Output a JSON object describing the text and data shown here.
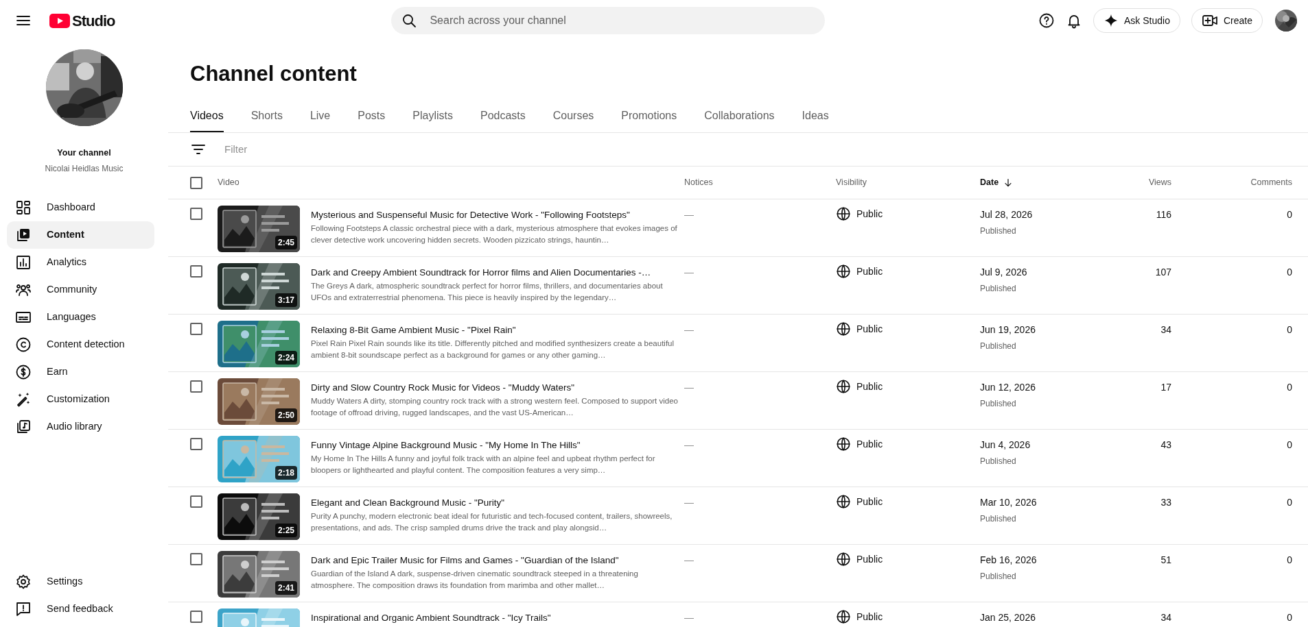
{
  "header": {
    "logo_text": "Studio",
    "search": {
      "placeholder": "Search across your channel"
    },
    "ask_button": "Ask Studio",
    "create_button": "Create"
  },
  "sidebar": {
    "channel_label": "Your channel",
    "channel_name": "Nicolai Heidlas Music",
    "items": [
      {
        "label": "Dashboard",
        "selected": false
      },
      {
        "label": "Content",
        "selected": true
      },
      {
        "label": "Analytics",
        "selected": false
      },
      {
        "label": "Community",
        "selected": false
      },
      {
        "label": "Languages",
        "selected": false
      },
      {
        "label": "Content detection",
        "selected": false
      },
      {
        "label": "Earn",
        "selected": false
      },
      {
        "label": "Customization",
        "selected": false
      },
      {
        "label": "Audio library",
        "selected": false
      }
    ],
    "footer_items": [
      {
        "label": "Settings"
      },
      {
        "label": "Send feedback"
      }
    ]
  },
  "page_title": "Channel content",
  "tabs": [
    {
      "label": "Videos",
      "selected": true
    },
    {
      "label": "Shorts",
      "selected": false
    },
    {
      "label": "Live",
      "selected": false
    },
    {
      "label": "Posts",
      "selected": false
    },
    {
      "label": "Playlists",
      "selected": false
    },
    {
      "label": "Podcasts",
      "selected": false
    },
    {
      "label": "Courses",
      "selected": false
    },
    {
      "label": "Promotions",
      "selected": false
    },
    {
      "label": "Collaborations",
      "selected": false
    },
    {
      "label": "Ideas",
      "selected": false
    }
  ],
  "filter": {
    "placeholder": "Filter"
  },
  "table": {
    "select_all": {
      "checked": false
    },
    "columns": [
      {
        "label": "Video",
        "sorted": false
      },
      {
        "label": "Notices",
        "sorted": false
      },
      {
        "label": "Visibility",
        "sorted": false
      },
      {
        "label": "Date",
        "sorted": true
      },
      {
        "label": "Views",
        "sorted": false
      },
      {
        "label": "Comments",
        "sorted": false
      }
    ],
    "rows": [
      {
        "checked": false,
        "duration": "2:45",
        "title": "Mysterious and Suspenseful Music for Detective Work - \"Following Footsteps\"",
        "description": "Following Footsteps A classic orchestral piece with a dark, mysterious atmosphere that evokes images of clever detective work uncovering hidden secrets. Wooden pizzicato strings, hauntin…",
        "notices": "—",
        "visibility": "Public",
        "date": "Jul 28, 2026",
        "status": "Published",
        "views": "116",
        "comments": "0"
      },
      {
        "checked": false,
        "duration": "3:17",
        "title": "Dark and Creepy Ambient Soundtrack for Horror films and Alien Documentaries -…",
        "description": "The Greys A dark, atmospheric soundtrack perfect for horror films, thrillers, and documentaries about UFOs and extraterrestrial phenomena. This piece is heavily inspired by the legendary…",
        "notices": "—",
        "visibility": "Public",
        "date": "Jul 9, 2026",
        "status": "Published",
        "views": "107",
        "comments": "0"
      },
      {
        "checked": false,
        "duration": "2:24",
        "title": "Relaxing 8-Bit Game Ambient Music - \"Pixel Rain\"",
        "description": "Pixel Rain Pixel Rain sounds like its title. Differently pitched and modified synthesizers create a beautiful ambient 8-bit soundscape perfect as a background for games or any other gaming…",
        "notices": "—",
        "visibility": "Public",
        "date": "Jun 19, 2026",
        "status": "Published",
        "views": "34",
        "comments": "0"
      },
      {
        "checked": false,
        "duration": "2:50",
        "title": "Dirty and Slow Country Rock Music for Videos - \"Muddy Waters\"",
        "description": "Muddy Waters A dirty, stomping country rock track with a strong western feel. Composed to support video footage of offroad driving, rugged landscapes, and the vast US-American…",
        "notices": "—",
        "visibility": "Public",
        "date": "Jun 12, 2026",
        "status": "Published",
        "views": "17",
        "comments": "0"
      },
      {
        "checked": false,
        "duration": "2:18",
        "title": "Funny Vintage Alpine Background Music - \"My Home In The Hills\"",
        "description": "My Home In The Hills A funny and joyful folk track with an alpine feel and upbeat rhythm perfect for bloopers or lighthearted and playful content. The composition features a very simp…",
        "notices": "—",
        "visibility": "Public",
        "date": "Jun 4, 2026",
        "status": "Published",
        "views": "43",
        "comments": "0"
      },
      {
        "checked": false,
        "duration": "2:25",
        "title": "Elegant and Clean Background Music - \"Purity\"",
        "description": "Purity A punchy, modern electronic beat ideal for futuristic and tech-focused content, trailers, showreels, presentations, and ads. The crisp sampled drums drive the track and play alongsid…",
        "notices": "—",
        "visibility": "Public",
        "date": "Mar 10, 2026",
        "status": "Published",
        "views": "33",
        "comments": "0"
      },
      {
        "checked": false,
        "duration": "2:41",
        "title": "Dark and Epic Trailer Music for Films and Games - \"Guardian of the Island\"",
        "description": "Guardian of the Island A dark, suspense-driven cinematic soundtrack steeped in a threatening atmosphere. The composition draws its foundation from marimba and other mallet…",
        "notices": "—",
        "visibility": "Public",
        "date": "Feb 16, 2026",
        "status": "Published",
        "views": "51",
        "comments": "0"
      },
      {
        "checked": false,
        "title": "Inspirational and Organic Ambient Soundtrack - \"Icy Trails\"",
        "notices": "—",
        "visibility": "Public",
        "date": "Jan 25, 2026",
        "views": "34",
        "comments": "0"
      }
    ]
  }
}
